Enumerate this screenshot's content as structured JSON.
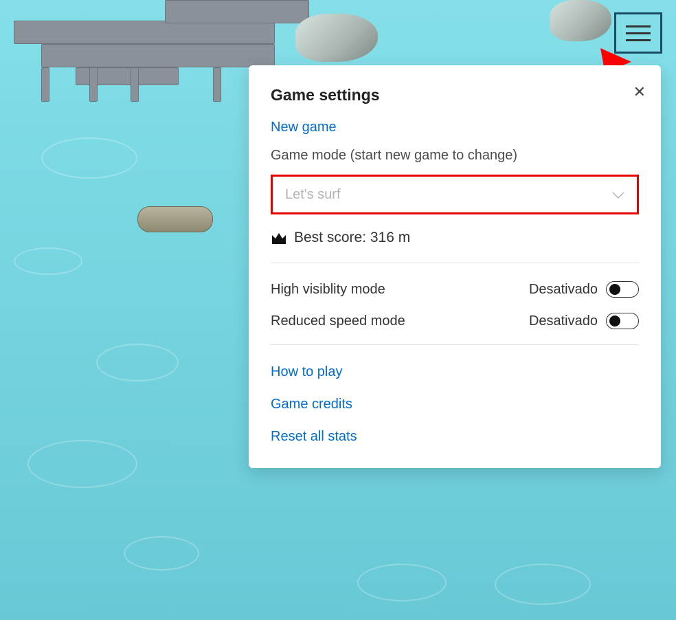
{
  "panel": {
    "title": "Game settings",
    "new_game": "New game",
    "mode_label": "Game mode (start new game to change)",
    "mode_selected": "Let's surf",
    "best_score_label": "Best score: 316 m",
    "toggles": {
      "high_visibility": {
        "label": "High visiblity mode",
        "state": "Desativado"
      },
      "reduced_speed": {
        "label": "Reduced speed mode",
        "state": "Desativado"
      }
    },
    "links": {
      "how_to_play": "How to play",
      "game_credits": "Game credits",
      "reset_stats": "Reset all stats"
    }
  },
  "icons": {
    "menu": "menu-icon",
    "close": "close-icon",
    "crown": "crown-icon",
    "chevron_down": "chevron-down-icon"
  }
}
